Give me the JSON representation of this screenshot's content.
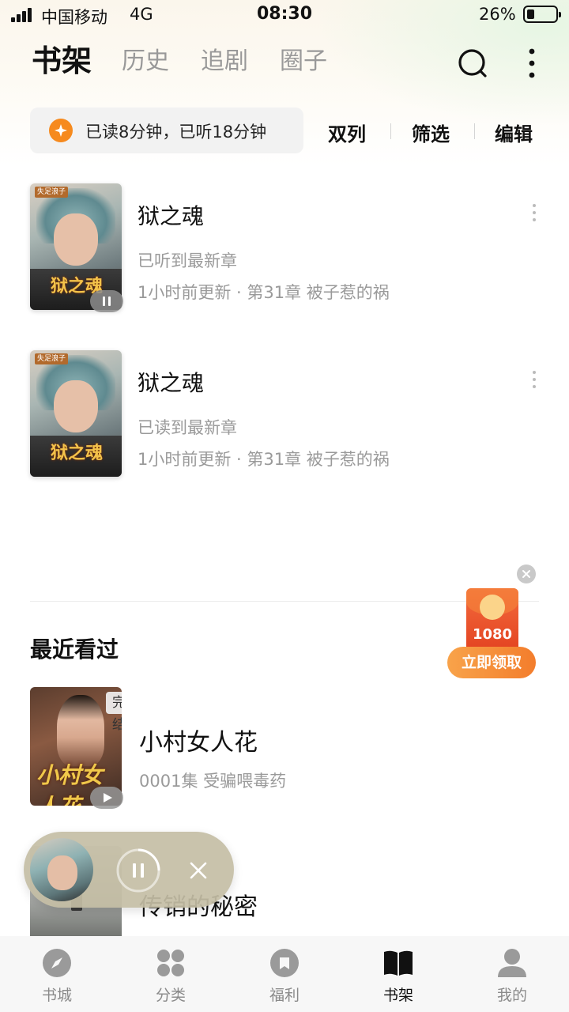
{
  "status_bar": {
    "carrier": "中国移动",
    "network": "4G",
    "time": "08:30",
    "battery": "26%"
  },
  "header": {
    "tabs": [
      {
        "label": "书架",
        "active": true
      },
      {
        "label": "历史",
        "active": false
      },
      {
        "label": "追剧",
        "active": false
      },
      {
        "label": "圈子",
        "active": false
      }
    ]
  },
  "stats": {
    "text": "已读8分钟，已听18分钟"
  },
  "actions": {
    "two_column": "双列",
    "filter": "筛选",
    "edit": "编辑"
  },
  "shelf": [
    {
      "title": "狱之魂",
      "cover_tag": "失足浪子",
      "cover_title": "狱之魂",
      "status": "已听到最新章",
      "update": "1小时前更新 · 第31章 被子惹的祸",
      "playing": true
    },
    {
      "title": "狱之魂",
      "cover_tag": "失足浪子",
      "cover_title": "狱之魂",
      "status": "已读到最新章",
      "update": "1小时前更新 · 第31章 被子惹的祸",
      "playing": false
    }
  ],
  "recent": {
    "heading": "最近看过",
    "items": [
      {
        "title": "小村女人花",
        "badge": "完结",
        "cover_title": "小村女人花",
        "episode": "0001集 受骗喂毒药"
      },
      {
        "title": "传销的秘密",
        "episode": ""
      }
    ]
  },
  "red_packet": {
    "amount": "1080",
    "button": "立即领取"
  },
  "bottom_nav": [
    {
      "label": "书城",
      "icon": "compass-icon",
      "active": false
    },
    {
      "label": "分类",
      "icon": "grid-icon",
      "active": false
    },
    {
      "label": "福利",
      "icon": "gift-icon",
      "active": false
    },
    {
      "label": "书架",
      "icon": "book-icon",
      "active": true
    },
    {
      "label": "我的",
      "icon": "person-icon",
      "active": false
    }
  ],
  "colors": {
    "accent_orange": "#f37d2c",
    "red_packet": "#e2401f",
    "text_secondary": "#9a9a9a"
  }
}
